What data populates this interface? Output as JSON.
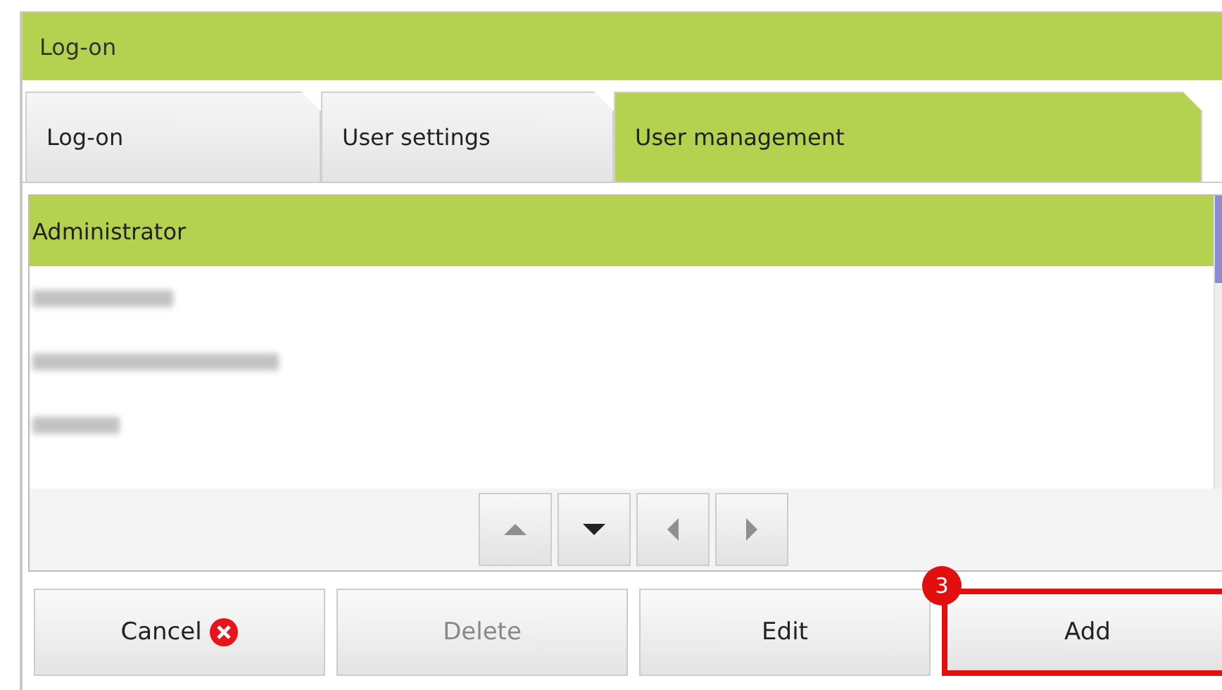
{
  "window": {
    "title": "Log-on"
  },
  "tabs": [
    {
      "label": "Log-on",
      "selected": false
    },
    {
      "label": "User settings",
      "selected": false
    },
    {
      "label": "User management",
      "selected": true
    }
  ],
  "users": [
    {
      "kind": "text",
      "name": "Administrator",
      "selected": true
    },
    {
      "kind": "blurred",
      "selected": false
    },
    {
      "kind": "blurred",
      "selected": false
    },
    {
      "kind": "blurred",
      "selected": false
    }
  ],
  "nav_buttons": [
    {
      "kind": "up",
      "disabled": true
    },
    {
      "kind": "down",
      "disabled": false
    },
    {
      "kind": "left",
      "disabled": true
    },
    {
      "kind": "right",
      "disabled": true
    }
  ],
  "actions": [
    {
      "label": "Cancel",
      "kind": "cancel",
      "disabled": false,
      "highlighted": false
    },
    {
      "label": "Delete",
      "kind": "plain",
      "disabled": true,
      "highlighted": false
    },
    {
      "label": "Edit",
      "kind": "plain",
      "disabled": false,
      "highlighted": false
    },
    {
      "label": "Add",
      "kind": "plain",
      "disabled": false,
      "highlighted": true,
      "badge": "3"
    }
  ]
}
